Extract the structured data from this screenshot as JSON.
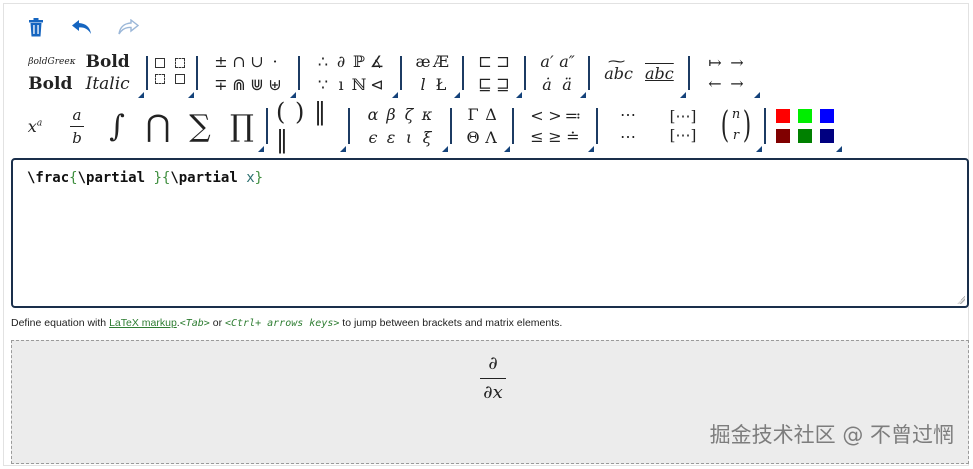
{
  "toolbar": {
    "delete_icon": "trash-icon",
    "undo_icon": "undo-arrow-icon",
    "redo_icon": "redo-arrow-icon",
    "icon_color": "#1565c0",
    "disabled_color": "#9bb7d8"
  },
  "palette": {
    "font_styles": {
      "top_left": "βoldGreeκ",
      "top_right": "Bold",
      "bottom_left": "Bold",
      "bottom_right": "Italic"
    },
    "operators": {
      "row1": [
        "±",
        "∩",
        "∪",
        "·"
      ],
      "row2": [
        "∓",
        "⋒",
        "⋓",
        "⊎"
      ]
    },
    "logic": {
      "row1": [
        "∴",
        "∂",
        "ℙ",
        "∡"
      ],
      "row2": [
        "∵",
        "ı",
        "ℕ",
        "⊲"
      ]
    },
    "letters": {
      "row1": [
        "æ",
        "Æ"
      ],
      "row2": [
        "l",
        "Ł"
      ]
    },
    "subsets": {
      "row1": [
        "⊏",
        "⊐"
      ],
      "row2": [
        "⊑",
        "⊒"
      ]
    },
    "accents": {
      "row1": [
        "a′",
        "a″"
      ],
      "row2": [
        "ȧ",
        "ä"
      ]
    },
    "overlines": {
      "wide_tilde": "abc",
      "overline": "abc"
    },
    "arrows": {
      "row1": [
        "↦",
        "→"
      ],
      "row2": [
        "←",
        "→"
      ]
    },
    "superscript": {
      "base": "x",
      "exp": "a"
    },
    "fraction": {
      "num": "a",
      "den": "b"
    },
    "big_ops": [
      "∫",
      "⋂",
      "∑",
      "∏"
    ],
    "delimiters": "( ) ‖ ‖",
    "greek_lower": {
      "row1": [
        "α",
        "β",
        "ζ",
        "κ"
      ],
      "row2": [
        "ϵ",
        "ε",
        "ι",
        "ξ"
      ]
    },
    "greek_upper": {
      "row1": [
        "Γ",
        "Δ"
      ],
      "row2": [
        "Θ",
        "Λ"
      ]
    },
    "relations": {
      "row1": [
        "<",
        ">",
        "≕"
      ],
      "row2": [
        "≤",
        "≥",
        "≐"
      ]
    },
    "dots": {
      "row1": "⋯",
      "row2": "⋯"
    },
    "matrix": {
      "row1": "[⋯]",
      "row2": "[⋯]"
    },
    "binom": {
      "top": "n",
      "bottom": "r"
    },
    "colors": [
      "#ff0000",
      "#00ee00",
      "#0000ff",
      "#800000",
      "#008000",
      "#000080"
    ]
  },
  "editor": {
    "cmd_frac": "\\frac",
    "open1": "{",
    "cmd_partial1": "\\partial ",
    "close1": "}",
    "open2": "{",
    "cmd_partial2": "\\partial ",
    "var": "x",
    "close2": "}"
  },
  "help": {
    "prefix": "Define equation with ",
    "link": "LaTeX markup",
    "dot": ".",
    "tab_key": "<Tab>",
    "or": " or ",
    "arrows_key": "<Ctrl+ arrows keys>",
    "suffix": " to jump between brackets and matrix elements."
  },
  "preview": {
    "numerator": "∂",
    "denominator": "∂x"
  },
  "watermark": "掘金技术社区 @ 不曾过惘"
}
